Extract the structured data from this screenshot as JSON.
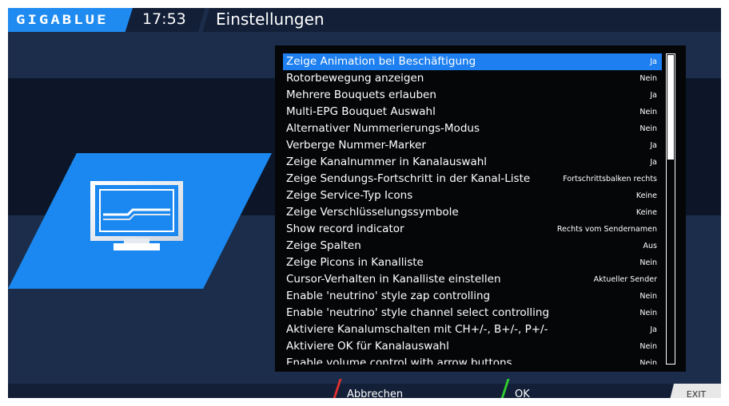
{
  "header": {
    "logo": "GIGABLUE",
    "clock": "17:53",
    "title": "Einstellungen"
  },
  "settings": [
    {
      "label": "Zeige Animation bei Beschäftigung",
      "value": "Ja",
      "selected": true
    },
    {
      "label": "Rotorbewegung anzeigen",
      "value": "Nein"
    },
    {
      "label": "Mehrere Bouquets erlauben",
      "value": "Ja"
    },
    {
      "label": "Multi-EPG Bouquet Auswahl",
      "value": "Nein"
    },
    {
      "label": "Alternativer Nummerierungs-Modus",
      "value": "Nein"
    },
    {
      "label": "Verberge Nummer-Marker",
      "value": "Ja"
    },
    {
      "label": "Zeige Kanalnummer in Kanalauswahl",
      "value": "Ja"
    },
    {
      "label": "Zeige Sendungs-Fortschritt in der Kanal-Liste",
      "value": "Fortschrittsbalken rechts"
    },
    {
      "label": "Zeige Service-Typ Icons",
      "value": "Keine"
    },
    {
      "label": "Zeige Verschlüsselungssymbole",
      "value": "Keine"
    },
    {
      "label": "Show record indicator",
      "value": "Rechts vom Sendernamen"
    },
    {
      "label": "Zeige Spalten",
      "value": "Aus"
    },
    {
      "label": "Zeige Picons in Kanalliste",
      "value": "Nein"
    },
    {
      "label": "Cursor-Verhalten in Kanalliste einstellen",
      "value": "Aktueller Sender"
    },
    {
      "label": "Enable 'neutrino' style zap controlling",
      "value": "Nein"
    },
    {
      "label": "Enable 'neutrino' style channel select controlling",
      "value": "Nein"
    },
    {
      "label": "Aktiviere Kanalumschalten mit CH+/-, B+/-, P+/-",
      "value": "Ja"
    },
    {
      "label": "Aktiviere OK für Kanalauswahl",
      "value": "Nein"
    },
    {
      "label": "Enable volume control with arrow buttons",
      "value": "Nein"
    }
  ],
  "scrollbar": {
    "visible_fraction": 0.34
  },
  "footer": {
    "cancel_label": "Abbrechen",
    "ok_label": "OK",
    "exit_label": "EXIT"
  },
  "colors": {
    "background": "#1b2d4a",
    "accent": "#1d7ff0",
    "cancel_key": "#e03030",
    "ok_key": "#2fcf2f"
  },
  "icons": {
    "settings_monitor": "monitor-icon"
  }
}
